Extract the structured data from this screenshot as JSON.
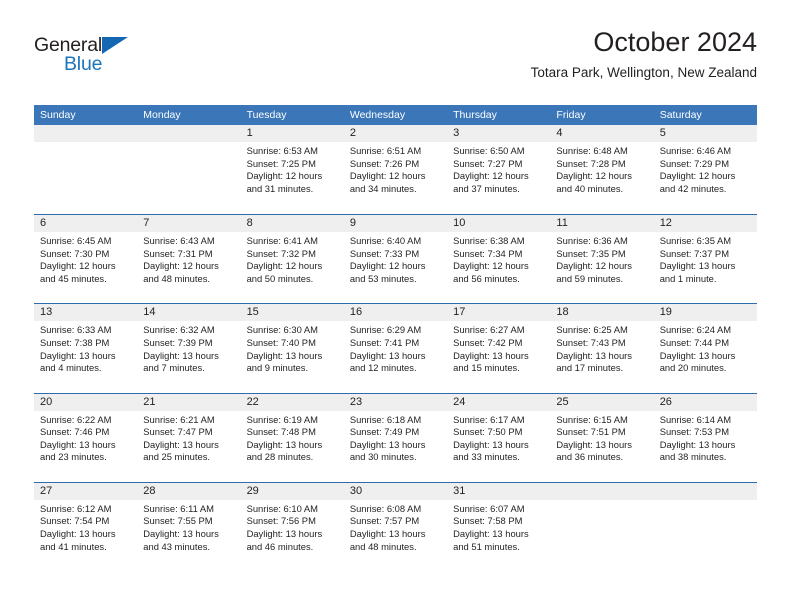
{
  "brand": {
    "name_part1": "General",
    "name_part2": "Blue",
    "triangle_icon": "triangle-icon",
    "accent_color": "#1b75bb"
  },
  "header": {
    "title": "October 2024",
    "subtitle": "Totara Park, Wellington, New Zealand"
  },
  "colors": {
    "header_blue": "#3a76b8",
    "row_divider_blue": "#2f6cae",
    "day_number_bg": "#efefef",
    "text": "#231f20"
  },
  "weekdays": [
    "Sunday",
    "Monday",
    "Tuesday",
    "Wednesday",
    "Thursday",
    "Friday",
    "Saturday"
  ],
  "weeks": [
    [
      {
        "day": "",
        "sunrise": "",
        "sunset": "",
        "daylight_line1": "",
        "daylight_line2": ""
      },
      {
        "day": "",
        "sunrise": "",
        "sunset": "",
        "daylight_line1": "",
        "daylight_line2": ""
      },
      {
        "day": "1",
        "sunrise": "Sunrise: 6:53 AM",
        "sunset": "Sunset: 7:25 PM",
        "daylight_line1": "Daylight: 12 hours",
        "daylight_line2": "and 31 minutes."
      },
      {
        "day": "2",
        "sunrise": "Sunrise: 6:51 AM",
        "sunset": "Sunset: 7:26 PM",
        "daylight_line1": "Daylight: 12 hours",
        "daylight_line2": "and 34 minutes."
      },
      {
        "day": "3",
        "sunrise": "Sunrise: 6:50 AM",
        "sunset": "Sunset: 7:27 PM",
        "daylight_line1": "Daylight: 12 hours",
        "daylight_line2": "and 37 minutes."
      },
      {
        "day": "4",
        "sunrise": "Sunrise: 6:48 AM",
        "sunset": "Sunset: 7:28 PM",
        "daylight_line1": "Daylight: 12 hours",
        "daylight_line2": "and 40 minutes."
      },
      {
        "day": "5",
        "sunrise": "Sunrise: 6:46 AM",
        "sunset": "Sunset: 7:29 PM",
        "daylight_line1": "Daylight: 12 hours",
        "daylight_line2": "and 42 minutes."
      }
    ],
    [
      {
        "day": "6",
        "sunrise": "Sunrise: 6:45 AM",
        "sunset": "Sunset: 7:30 PM",
        "daylight_line1": "Daylight: 12 hours",
        "daylight_line2": "and 45 minutes."
      },
      {
        "day": "7",
        "sunrise": "Sunrise: 6:43 AM",
        "sunset": "Sunset: 7:31 PM",
        "daylight_line1": "Daylight: 12 hours",
        "daylight_line2": "and 48 minutes."
      },
      {
        "day": "8",
        "sunrise": "Sunrise: 6:41 AM",
        "sunset": "Sunset: 7:32 PM",
        "daylight_line1": "Daylight: 12 hours",
        "daylight_line2": "and 50 minutes."
      },
      {
        "day": "9",
        "sunrise": "Sunrise: 6:40 AM",
        "sunset": "Sunset: 7:33 PM",
        "daylight_line1": "Daylight: 12 hours",
        "daylight_line2": "and 53 minutes."
      },
      {
        "day": "10",
        "sunrise": "Sunrise: 6:38 AM",
        "sunset": "Sunset: 7:34 PM",
        "daylight_line1": "Daylight: 12 hours",
        "daylight_line2": "and 56 minutes."
      },
      {
        "day": "11",
        "sunrise": "Sunrise: 6:36 AM",
        "sunset": "Sunset: 7:35 PM",
        "daylight_line1": "Daylight: 12 hours",
        "daylight_line2": "and 59 minutes."
      },
      {
        "day": "12",
        "sunrise": "Sunrise: 6:35 AM",
        "sunset": "Sunset: 7:37 PM",
        "daylight_line1": "Daylight: 13 hours",
        "daylight_line2": "and 1 minute."
      }
    ],
    [
      {
        "day": "13",
        "sunrise": "Sunrise: 6:33 AM",
        "sunset": "Sunset: 7:38 PM",
        "daylight_line1": "Daylight: 13 hours",
        "daylight_line2": "and 4 minutes."
      },
      {
        "day": "14",
        "sunrise": "Sunrise: 6:32 AM",
        "sunset": "Sunset: 7:39 PM",
        "daylight_line1": "Daylight: 13 hours",
        "daylight_line2": "and 7 minutes."
      },
      {
        "day": "15",
        "sunrise": "Sunrise: 6:30 AM",
        "sunset": "Sunset: 7:40 PM",
        "daylight_line1": "Daylight: 13 hours",
        "daylight_line2": "and 9 minutes."
      },
      {
        "day": "16",
        "sunrise": "Sunrise: 6:29 AM",
        "sunset": "Sunset: 7:41 PM",
        "daylight_line1": "Daylight: 13 hours",
        "daylight_line2": "and 12 minutes."
      },
      {
        "day": "17",
        "sunrise": "Sunrise: 6:27 AM",
        "sunset": "Sunset: 7:42 PM",
        "daylight_line1": "Daylight: 13 hours",
        "daylight_line2": "and 15 minutes."
      },
      {
        "day": "18",
        "sunrise": "Sunrise: 6:25 AM",
        "sunset": "Sunset: 7:43 PM",
        "daylight_line1": "Daylight: 13 hours",
        "daylight_line2": "and 17 minutes."
      },
      {
        "day": "19",
        "sunrise": "Sunrise: 6:24 AM",
        "sunset": "Sunset: 7:44 PM",
        "daylight_line1": "Daylight: 13 hours",
        "daylight_line2": "and 20 minutes."
      }
    ],
    [
      {
        "day": "20",
        "sunrise": "Sunrise: 6:22 AM",
        "sunset": "Sunset: 7:46 PM",
        "daylight_line1": "Daylight: 13 hours",
        "daylight_line2": "and 23 minutes."
      },
      {
        "day": "21",
        "sunrise": "Sunrise: 6:21 AM",
        "sunset": "Sunset: 7:47 PM",
        "daylight_line1": "Daylight: 13 hours",
        "daylight_line2": "and 25 minutes."
      },
      {
        "day": "22",
        "sunrise": "Sunrise: 6:19 AM",
        "sunset": "Sunset: 7:48 PM",
        "daylight_line1": "Daylight: 13 hours",
        "daylight_line2": "and 28 minutes."
      },
      {
        "day": "23",
        "sunrise": "Sunrise: 6:18 AM",
        "sunset": "Sunset: 7:49 PM",
        "daylight_line1": "Daylight: 13 hours",
        "daylight_line2": "and 30 minutes."
      },
      {
        "day": "24",
        "sunrise": "Sunrise: 6:17 AM",
        "sunset": "Sunset: 7:50 PM",
        "daylight_line1": "Daylight: 13 hours",
        "daylight_line2": "and 33 minutes."
      },
      {
        "day": "25",
        "sunrise": "Sunrise: 6:15 AM",
        "sunset": "Sunset: 7:51 PM",
        "daylight_line1": "Daylight: 13 hours",
        "daylight_line2": "and 36 minutes."
      },
      {
        "day": "26",
        "sunrise": "Sunrise: 6:14 AM",
        "sunset": "Sunset: 7:53 PM",
        "daylight_line1": "Daylight: 13 hours",
        "daylight_line2": "and 38 minutes."
      }
    ],
    [
      {
        "day": "27",
        "sunrise": "Sunrise: 6:12 AM",
        "sunset": "Sunset: 7:54 PM",
        "daylight_line1": "Daylight: 13 hours",
        "daylight_line2": "and 41 minutes."
      },
      {
        "day": "28",
        "sunrise": "Sunrise: 6:11 AM",
        "sunset": "Sunset: 7:55 PM",
        "daylight_line1": "Daylight: 13 hours",
        "daylight_line2": "and 43 minutes."
      },
      {
        "day": "29",
        "sunrise": "Sunrise: 6:10 AM",
        "sunset": "Sunset: 7:56 PM",
        "daylight_line1": "Daylight: 13 hours",
        "daylight_line2": "and 46 minutes."
      },
      {
        "day": "30",
        "sunrise": "Sunrise: 6:08 AM",
        "sunset": "Sunset: 7:57 PM",
        "daylight_line1": "Daylight: 13 hours",
        "daylight_line2": "and 48 minutes."
      },
      {
        "day": "31",
        "sunrise": "Sunrise: 6:07 AM",
        "sunset": "Sunset: 7:58 PM",
        "daylight_line1": "Daylight: 13 hours",
        "daylight_line2": "and 51 minutes."
      },
      {
        "day": "",
        "sunrise": "",
        "sunset": "",
        "daylight_line1": "",
        "daylight_line2": ""
      },
      {
        "day": "",
        "sunrise": "",
        "sunset": "",
        "daylight_line1": "",
        "daylight_line2": ""
      }
    ]
  ]
}
